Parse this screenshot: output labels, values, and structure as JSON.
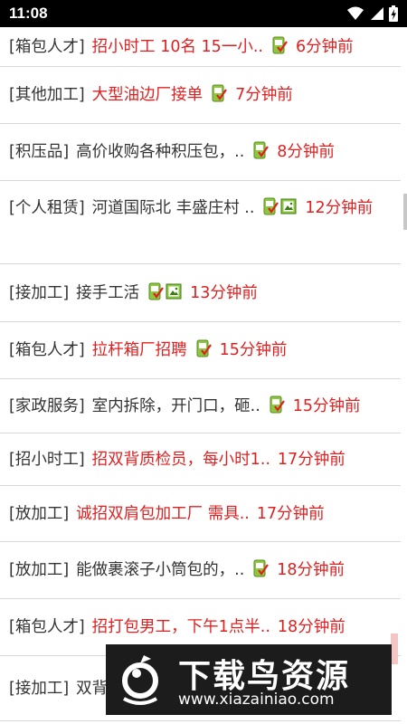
{
  "status_bar": {
    "time": "11:08"
  },
  "listings": [
    {
      "category": "[箱包人才]",
      "title": "招小时工 10名 15一小..",
      "title_color": "red",
      "icons": [
        "phone-check-icon"
      ],
      "time": "6分钟前"
    },
    {
      "category": "[其他加工]",
      "title": "大型油边厂接单",
      "title_color": "red",
      "icons": [
        "phone-check-icon"
      ],
      "time": "7分钟前"
    },
    {
      "category": "[积压品]",
      "title": "高价收购各种积压包，..",
      "title_color": "dark",
      "icons": [
        "phone-check-icon"
      ],
      "time": "8分钟前"
    },
    {
      "category": "[个人租赁]",
      "title": "河道国际北 丰盛庄村 ..",
      "title_color": "dark",
      "icons": [
        "phone-check-icon",
        "picture-icon"
      ],
      "time": "12分钟前"
    },
    {
      "category": "[接加工]",
      "title": "接手工活",
      "title_color": "dark",
      "icons": [
        "phone-check-icon",
        "picture-icon"
      ],
      "time": "13分钟前"
    },
    {
      "category": "[箱包人才]",
      "title": "拉杆箱厂招聘",
      "title_color": "red",
      "icons": [
        "phone-check-icon"
      ],
      "time": "15分钟前"
    },
    {
      "category": "[家政服务]",
      "title": "室内拆除，开门口，砸..",
      "title_color": "dark",
      "icons": [
        "phone-check-icon"
      ],
      "time": "15分钟前"
    },
    {
      "category": "[招小时工]",
      "title": "招双背质检员，每小时1..",
      "title_color": "red",
      "icons": [],
      "time": "17分钟前"
    },
    {
      "category": "[放加工]",
      "title": "诚招双肩包加工厂 需具..",
      "title_color": "red",
      "icons": [],
      "time": "17分钟前"
    },
    {
      "category": "[放加工]",
      "title": "能做裹滚子小筒包的，..",
      "title_color": "dark",
      "icons": [
        "phone-check-icon"
      ],
      "time": "18分钟前"
    },
    {
      "category": "[箱包人才]",
      "title": "招打包男工，下午1点半..",
      "title_color": "red",
      "icons": [],
      "time": "18分钟前"
    },
    {
      "category": "[接加工]",
      "title": "双背",
      "title_color": "dark",
      "icons": [],
      "time": ""
    }
  ],
  "watermark": {
    "title": "下载鸟资源",
    "url": "www.xiazainiao.com"
  },
  "colors": {
    "accent_red": "#e02020",
    "text_dark": "#333333",
    "divider": "#d8d8d8",
    "icon_green": "#8dc63f"
  }
}
